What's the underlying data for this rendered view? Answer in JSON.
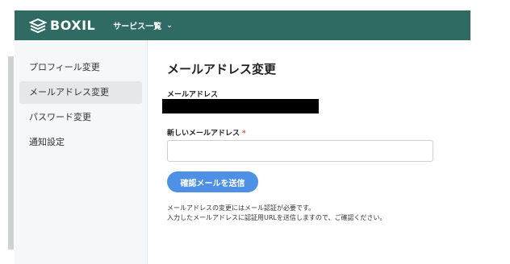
{
  "header": {
    "brand": "BOXIL",
    "services_label": "サービス一覧"
  },
  "sidebar": {
    "items": [
      {
        "label": "プロフィール変更",
        "active": false
      },
      {
        "label": "メールアドレス変更",
        "active": true
      },
      {
        "label": "パスワード変更",
        "active": false
      },
      {
        "label": "通知設定",
        "active": false
      }
    ]
  },
  "main": {
    "title": "メールアドレス変更",
    "current_email_label": "メールアドレス",
    "new_email_label": "新しいメールアドレス",
    "required_mark": "*",
    "new_email_value": "",
    "new_email_placeholder": "",
    "submit_label": "確認メールを送信",
    "note_lines": [
      "メールアドレスの変更にはメール認証が必要です。",
      "入力したメールアドレスに認証用URLを送信しますので、ご確認ください。"
    ]
  },
  "colors": {
    "header_bg": "#2f6b63",
    "button_bg": "#4d90e6",
    "required": "#e04a4a"
  }
}
